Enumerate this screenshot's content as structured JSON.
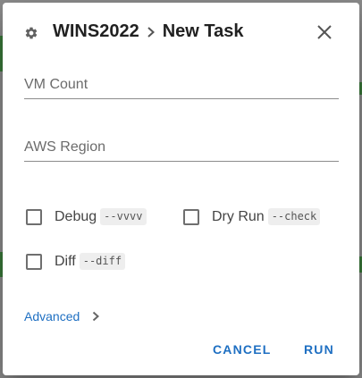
{
  "dialog": {
    "breadcrumb_parent": "WINS2022",
    "title": "New Task"
  },
  "fields": {
    "vm_count_placeholder": "VM Count",
    "aws_region_placeholder": "AWS Region"
  },
  "options": {
    "debug": {
      "label": "Debug",
      "flag": "--vvvv",
      "checked": false
    },
    "dry_run": {
      "label": "Dry Run",
      "flag": "--check",
      "checked": false
    },
    "diff": {
      "label": "Diff",
      "flag": "--diff",
      "checked": false
    }
  },
  "advanced_label": "Advanced",
  "actions": {
    "cancel": "CANCEL",
    "run": "RUN"
  },
  "icons": {
    "gear": "gear-icon",
    "breadcrumb_separator": "chevron-right-icon",
    "close": "close-icon",
    "advanced_expand": "chevron-right-icon"
  },
  "colors": {
    "accent": "#1e6fc2",
    "title": "#212121",
    "backdrop": "#8d8d8d"
  }
}
